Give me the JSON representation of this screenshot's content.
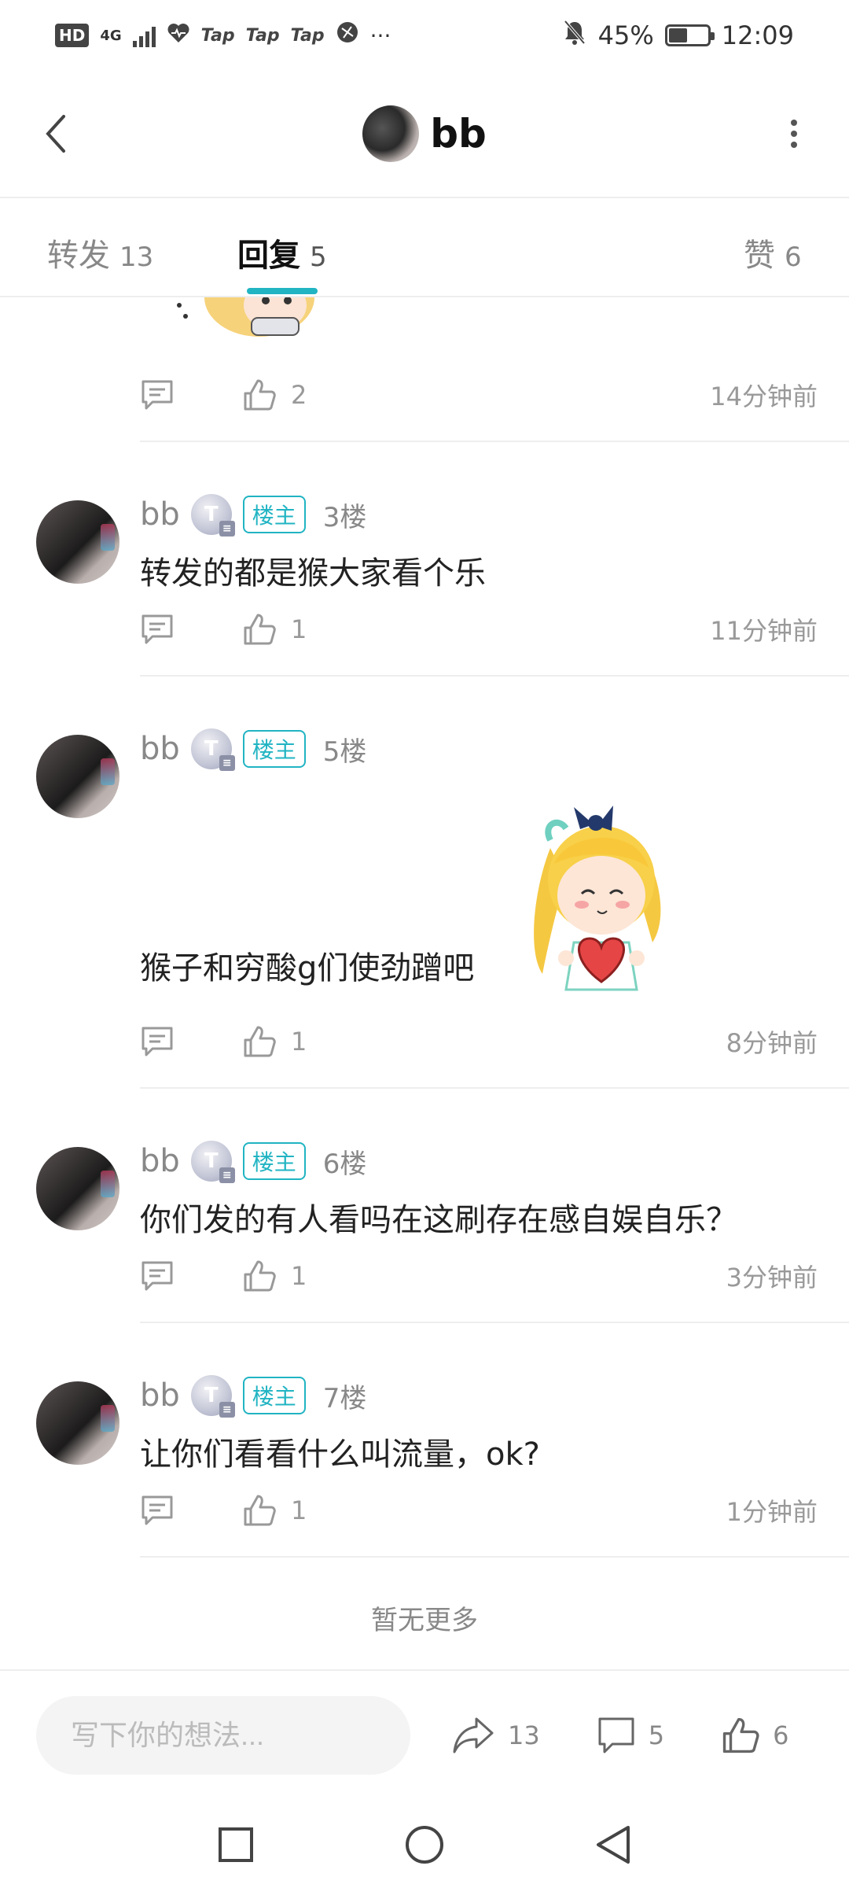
{
  "status_bar": {
    "hd": "HD",
    "network": "4G",
    "app_labels": [
      "Tap",
      "Tap",
      "Tap"
    ],
    "more": "···",
    "battery": "45%",
    "battery_level": 0.45,
    "time": "12:09"
  },
  "header": {
    "title": "bb"
  },
  "tabs": [
    {
      "label": "转发",
      "count": "13"
    },
    {
      "label": "回复",
      "count": "5"
    },
    {
      "label": "赞",
      "count": "6"
    }
  ],
  "top_item": {
    "likes": "2",
    "time": "14分钟前"
  },
  "comments": [
    {
      "user": "bb",
      "tag": "楼主",
      "floor": "3楼",
      "text": "转发的都是猴大家看个乐",
      "likes": "1",
      "time": "11分钟前"
    },
    {
      "user": "bb",
      "tag": "楼主",
      "floor": "5楼",
      "text": "猴子和穷酸g们使劲蹭吧",
      "likes": "1",
      "time": "8分钟前"
    },
    {
      "user": "bb",
      "tag": "楼主",
      "floor": "6楼",
      "text": "你们发的有人看吗在这刷存在感自娱自乐？",
      "likes": "1",
      "time": "3分钟前"
    },
    {
      "user": "bb",
      "tag": "楼主",
      "floor": "7楼",
      "text": "让你们看看什么叫流量，ok?",
      "likes": "1",
      "time": "1分钟前"
    }
  ],
  "no_more": "暂无更多",
  "bottom_bar": {
    "placeholder": "写下你的想法...",
    "share_count": "13",
    "reply_count": "5",
    "like_count": "6"
  },
  "colors": {
    "accent": "#21b4c3",
    "muted_text": "#888888",
    "primary_text": "#222222"
  },
  "icons": [
    "back-icon",
    "more-vertical-icon",
    "reply-icon",
    "thumbs-up-icon",
    "share-icon",
    "square-icon",
    "circle-icon",
    "triangle-back-icon",
    "mute-icon",
    "heart-status-icon",
    "battery-icon"
  ]
}
